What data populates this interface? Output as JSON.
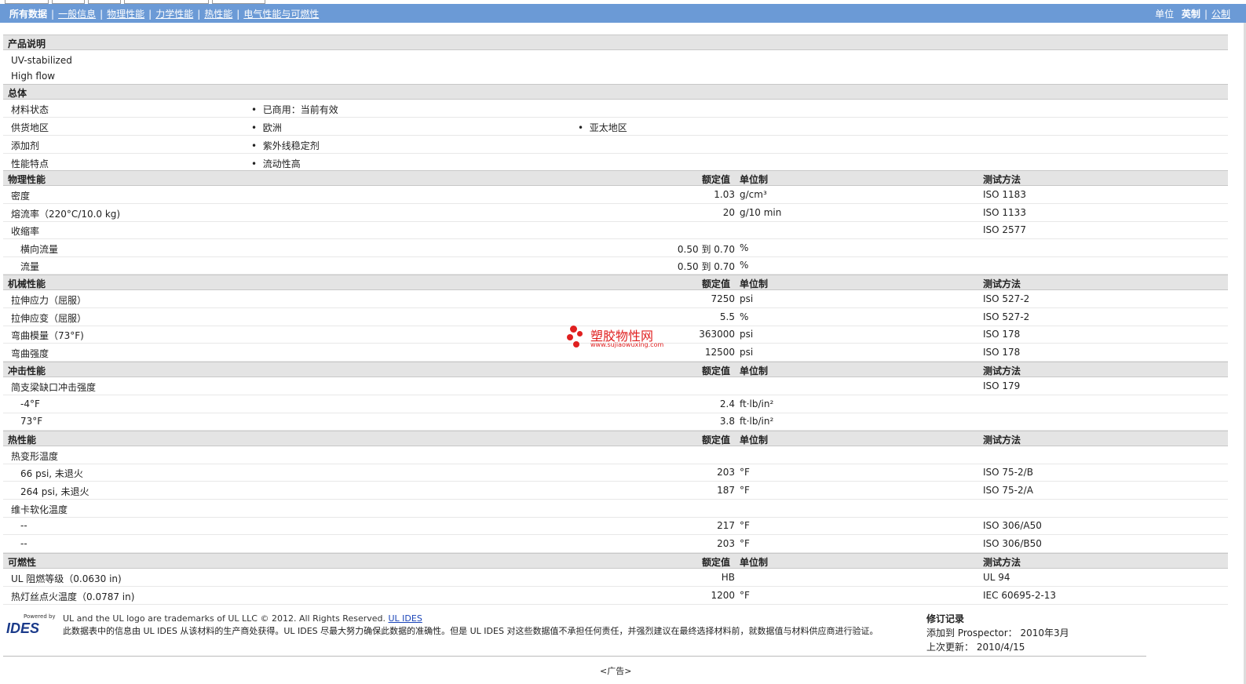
{
  "nav": {
    "items": [
      "所有数据",
      "一般信息",
      "物理性能",
      "力学性能",
      "热性能",
      "电气性能与可燃性"
    ],
    "units_label": "单位",
    "unit_options": [
      "英制",
      "公制"
    ]
  },
  "product": {
    "title": "产品说明",
    "lines": [
      "UV-stabilized",
      "High flow"
    ]
  },
  "general": {
    "title": "总体",
    "rows": [
      {
        "label": "材料状态",
        "b1": "已商用：当前有效",
        "b2": ""
      },
      {
        "label": "供货地区",
        "b1": "欧洲",
        "b2": "亚太地区"
      },
      {
        "label": "添加剂",
        "b1": "紫外线稳定剂",
        "b2": ""
      },
      {
        "label": "性能特点",
        "b1": "流动性高",
        "b2": ""
      }
    ]
  },
  "headers": {
    "rated": "额定值",
    "unit": "单位制",
    "test": "测试方法"
  },
  "physical": {
    "title": "物理性能",
    "rows": [
      {
        "label": "密度",
        "value": "1.03",
        "unit": "g/cm³",
        "test": "ISO 1183",
        "indent": false
      },
      {
        "label": "熔流率（220°C/10.0 kg)",
        "value": "20",
        "unit": "g/10 min",
        "test": "ISO 1133",
        "indent": false
      },
      {
        "label": "收缩率",
        "value": "",
        "unit": "",
        "test": "ISO 2577",
        "indent": false
      },
      {
        "label": "横向流量",
        "value": "0.50 到  0.70",
        "unit": "%",
        "test": "",
        "indent": true
      },
      {
        "label": "流量",
        "value": "0.50 到  0.70",
        "unit": "%",
        "test": "",
        "indent": true
      }
    ]
  },
  "mechanical": {
    "title": "机械性能",
    "rows": [
      {
        "label": "拉伸应力（屈服）",
        "value": "7250",
        "unit": "psi",
        "test": "ISO 527-2",
        "indent": false
      },
      {
        "label": "拉伸应变（屈服）",
        "value": "5.5",
        "unit": "%",
        "test": "ISO 527-2",
        "indent": false
      },
      {
        "label": "弯曲模量（73°F)",
        "value": "363000",
        "unit": "psi",
        "test": "ISO 178",
        "indent": false
      },
      {
        "label": "弯曲强度",
        "value": "12500",
        "unit": "psi",
        "test": "ISO 178",
        "indent": false
      }
    ]
  },
  "impact": {
    "title": "冲击性能",
    "rows": [
      {
        "label": "简支梁缺口冲击强度",
        "value": "",
        "unit": "",
        "test": "ISO 179",
        "indent": false
      },
      {
        "label": "-4°F",
        "value": "2.4",
        "unit": "ft·lb/in²",
        "test": "",
        "indent": true
      },
      {
        "label": "73°F",
        "value": "3.8",
        "unit": "ft·lb/in²",
        "test": "",
        "indent": true
      }
    ]
  },
  "thermal": {
    "title": "热性能",
    "rows": [
      {
        "label": "热变形温度",
        "value": "",
        "unit": "",
        "test": "",
        "indent": false
      },
      {
        "label": "66 psi, 未退火",
        "value": "203",
        "unit": "°F",
        "test": "ISO 75-2/B",
        "indent": true
      },
      {
        "label": "264 psi, 未退火",
        "value": "187",
        "unit": "°F",
        "test": "ISO 75-2/A",
        "indent": true
      },
      {
        "label": "维卡软化温度",
        "value": "",
        "unit": "",
        "test": "",
        "indent": false
      },
      {
        "label": "--",
        "value": "217",
        "unit": "°F",
        "test": "ISO 306/A50",
        "indent": true
      },
      {
        "label": "--",
        "value": "203",
        "unit": "°F",
        "test": "ISO 306/B50",
        "indent": true
      }
    ]
  },
  "flammability": {
    "title": "可燃性",
    "rows": [
      {
        "label": "UL 阻燃等级（0.0630 in)",
        "value": "HB",
        "unit": "",
        "test": "UL 94",
        "indent": false
      },
      {
        "label": "热灯丝点火温度（0.0787 in)",
        "value": "1200",
        "unit": "°F",
        "test": "IEC 60695-2-13",
        "indent": false
      }
    ]
  },
  "watermark": {
    "text": "塑胶物性网",
    "url": "www.sujiaowuxing.com"
  },
  "footer": {
    "logo_small": "Powered by",
    "logo_text": "IDES",
    "trademark": "UL and the UL logo are trademarks of UL LLC © 2012. All Rights Reserved.",
    "trademark_link": "UL IDES",
    "disclaimer": "此数据表中的信息由  UL IDES 从该材料的生产商处获得。UL IDES 尽最大努力确保此数据的准确性。但是  UL IDES 对这些数据值不承担任何责任，并强烈建议在最终选择材料前，就数据值与材料供应商进行验证。",
    "rev_title": "修订记录",
    "rev_added": "添加到  Prospector：  2010年3月",
    "rev_updated": "上次更新：   2010/4/15",
    "ad": "<广告>"
  },
  "colors": {
    "nav": "#6b9ad6",
    "section": "#e4e4e4",
    "watermark": "#e02020"
  }
}
